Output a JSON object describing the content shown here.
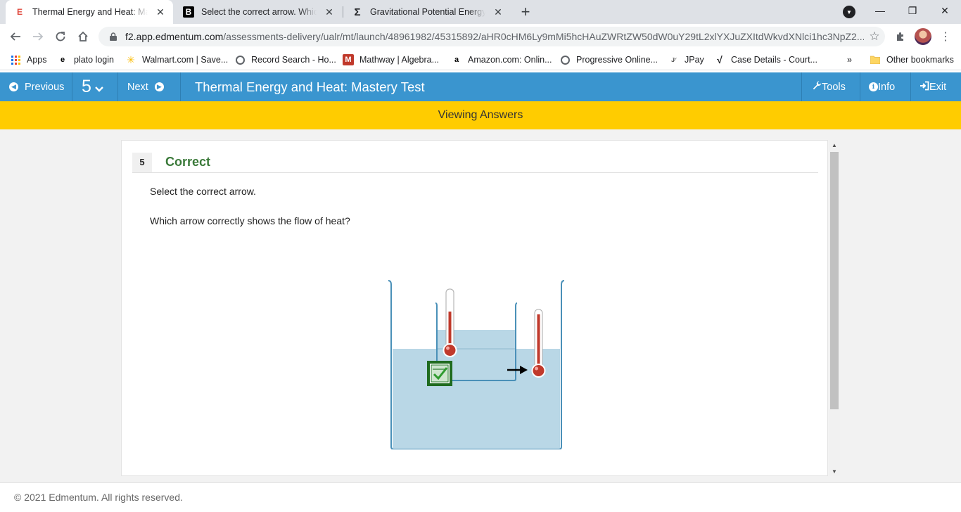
{
  "browser": {
    "tabs": [
      {
        "title": "Thermal Energy and Heat: Mastery Test",
        "favicon": "E"
      },
      {
        "title": "Select the correct arrow. Which arrow correctly shows",
        "favicon": "B"
      },
      {
        "title": "Gravitational Potential Energy Calculator",
        "favicon": "Σ"
      }
    ],
    "new_tab": "+",
    "controls": {
      "minimize": "—",
      "restore": "❐",
      "close": "✕"
    },
    "url_host": "f2.app.edmentum.com",
    "url_path": "/assessments-delivery/ualr/mt/launch/48961982/45315892/aHR0cHM6Ly9mMi5hcHAuZWRtZW50dW0uY29tL2xlYXJuZXItdWkvdXNlci1hc3NpZ2...",
    "bookmarks": [
      {
        "label": "Apps"
      },
      {
        "label": "plato login"
      },
      {
        "label": "Walmart.com | Save..."
      },
      {
        "label": "Record Search - Ho..."
      },
      {
        "label": "Mathway | Algebra..."
      },
      {
        "label": "Amazon.com: Onlin..."
      },
      {
        "label": "Progressive Online..."
      },
      {
        "label": "JPay"
      },
      {
        "label": "Case Details - Court..."
      }
    ],
    "more_bookmarks": "»",
    "other_bookmarks": "Other bookmarks"
  },
  "header": {
    "previous": "Previous",
    "question_number": "5",
    "next": "Next",
    "title": "Thermal Energy and Heat: Mastery Test",
    "tools": "Tools",
    "info": "Info",
    "exit": "Exit"
  },
  "banner": "Viewing Answers",
  "question": {
    "number": "5",
    "status": "Correct",
    "instruction": "Select the correct arrow.",
    "prompt": "Which arrow correctly shows the flow of heat?"
  },
  "footer": "© 2021 Edmentum. All rights reserved.",
  "colors": {
    "header": "#3a95cf",
    "banner": "#ffcc00",
    "correct": "#3b7a3a",
    "water": "#b9d7e6",
    "mercury": "#c0392b"
  }
}
